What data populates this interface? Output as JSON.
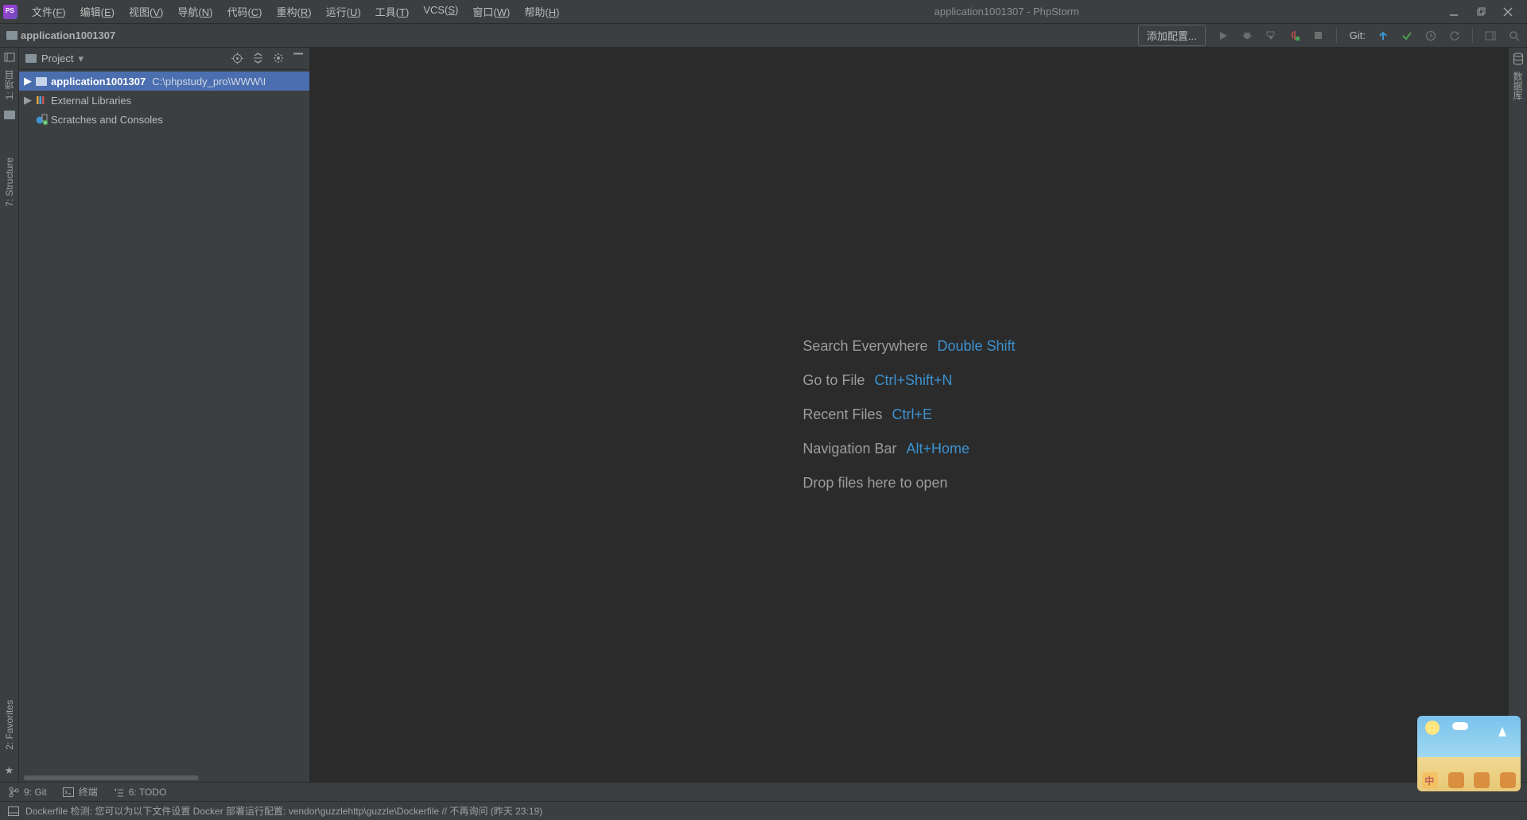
{
  "titlebar": {
    "title": "application1001307 - PhpStorm"
  },
  "menubar": [
    {
      "label": "文件",
      "mn": "F"
    },
    {
      "label": "编辑",
      "mn": "E"
    },
    {
      "label": "视图",
      "mn": "V"
    },
    {
      "label": "导航",
      "mn": "N"
    },
    {
      "label": "代码",
      "mn": "C"
    },
    {
      "label": "重构",
      "mn": "R"
    },
    {
      "label": "运行",
      "mn": "U"
    },
    {
      "label": "工具",
      "mn": "T"
    },
    {
      "label": "VCS",
      "mn": "S"
    },
    {
      "label": "窗口",
      "mn": "W"
    },
    {
      "label": "帮助",
      "mn": "H"
    }
  ],
  "breadcrumb": {
    "project": "application1001307"
  },
  "toolbar": {
    "run_config": "添加配置...",
    "git_label": "Git:"
  },
  "project_panel": {
    "title": "Project",
    "root": {
      "name": "application1001307",
      "path": "C:\\phpstudy_pro\\WWW\\I"
    },
    "external_libs": "External Libraries",
    "scratches": "Scratches and Consoles"
  },
  "left_gutter": {
    "project": "1: 项目",
    "structure": "7: Structure",
    "favorites": "2: Favorites"
  },
  "right_gutter": {
    "db": "数据库"
  },
  "editor_hints": [
    {
      "label": "Search Everywhere",
      "key": "Double Shift"
    },
    {
      "label": "Go to File",
      "key": "Ctrl+Shift+N"
    },
    {
      "label": "Recent Files",
      "key": "Ctrl+E"
    },
    {
      "label": "Navigation Bar",
      "key": "Alt+Home"
    },
    {
      "label": "Drop files here to open",
      "key": ""
    }
  ],
  "bottom_tabs": {
    "git": "9: Git",
    "terminal": "终端",
    "todo": "6: TODO"
  },
  "statusbar": {
    "message": "Dockerfile 检测: 您可以为以下文件设置 Docker 部署运行配置: vendor\\guzzlehttp\\guzzle\\Dockerfile // 不再询问 (昨天 23:19)"
  }
}
